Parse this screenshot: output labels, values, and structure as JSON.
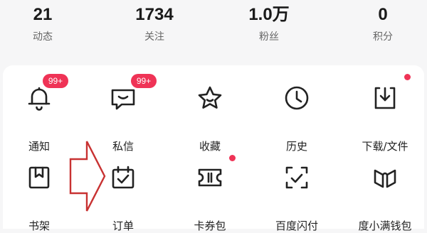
{
  "stats": [
    {
      "value": "21",
      "label": "动态"
    },
    {
      "value": "1734",
      "label": "关注"
    },
    {
      "value": "1.0万",
      "label": "粉丝"
    },
    {
      "value": "0",
      "label": "积分"
    }
  ],
  "grid": {
    "row1": [
      {
        "label": "通知",
        "icon": "bell-icon",
        "badge": "99+"
      },
      {
        "label": "私信",
        "icon": "message-icon",
        "badge": "99+"
      },
      {
        "label": "收藏",
        "icon": "star-icon"
      },
      {
        "label": "历史",
        "icon": "clock-icon"
      },
      {
        "label": "下载/文件",
        "icon": "download-icon",
        "dot": true
      }
    ],
    "row2": [
      {
        "label": "书架",
        "icon": "bookmark-icon"
      },
      {
        "label": "订单",
        "icon": "calendar-check-icon"
      },
      {
        "label": "卡券包",
        "icon": "ticket-icon",
        "dot": true
      },
      {
        "label": "百度闪付",
        "icon": "scan-check-icon"
      },
      {
        "label": "度小满钱包",
        "icon": "wallet-logo-icon"
      }
    ]
  },
  "colors": {
    "accent": "#ef3356",
    "icon_stroke": "#222222",
    "annotation_arrow": "#c83232"
  }
}
